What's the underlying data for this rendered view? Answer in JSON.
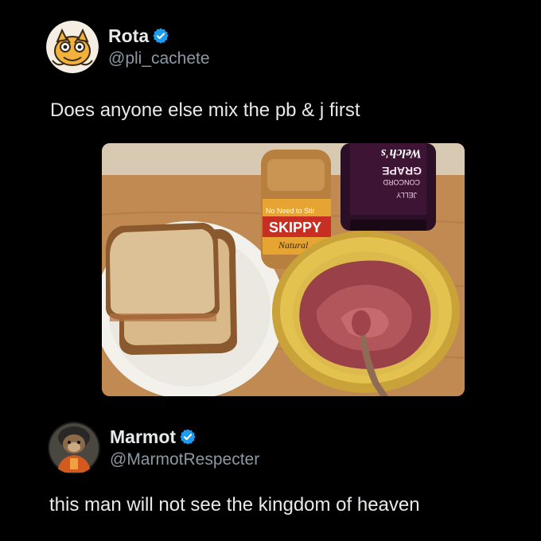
{
  "posts": [
    {
      "display_name": "Rota",
      "handle": "@pli_cachete",
      "text": "Does anyone else mix the pb & j first",
      "verified": true,
      "media": {
        "jar_label_brand": "SKIPPY",
        "jar_label_tagline": "No Need to Stir",
        "jar_label_variety": "Natural",
        "bottle_brand": "Welch's",
        "bottle_flavor_line1": "CONCORD",
        "bottle_flavor_line2": "GRAPE",
        "bottle_type": "JELLY"
      }
    },
    {
      "display_name": "Marmot",
      "handle": "@MarmotRespecter",
      "text": "this man will not see the kingdom of heaven",
      "verified": true
    }
  ],
  "colors": {
    "background": "#000000",
    "text_primary": "#e7e9ea",
    "text_secondary": "#8b98a5",
    "verified_badge": "#1d9bf0"
  },
  "icons": {
    "verified": "verified-badge-icon"
  }
}
